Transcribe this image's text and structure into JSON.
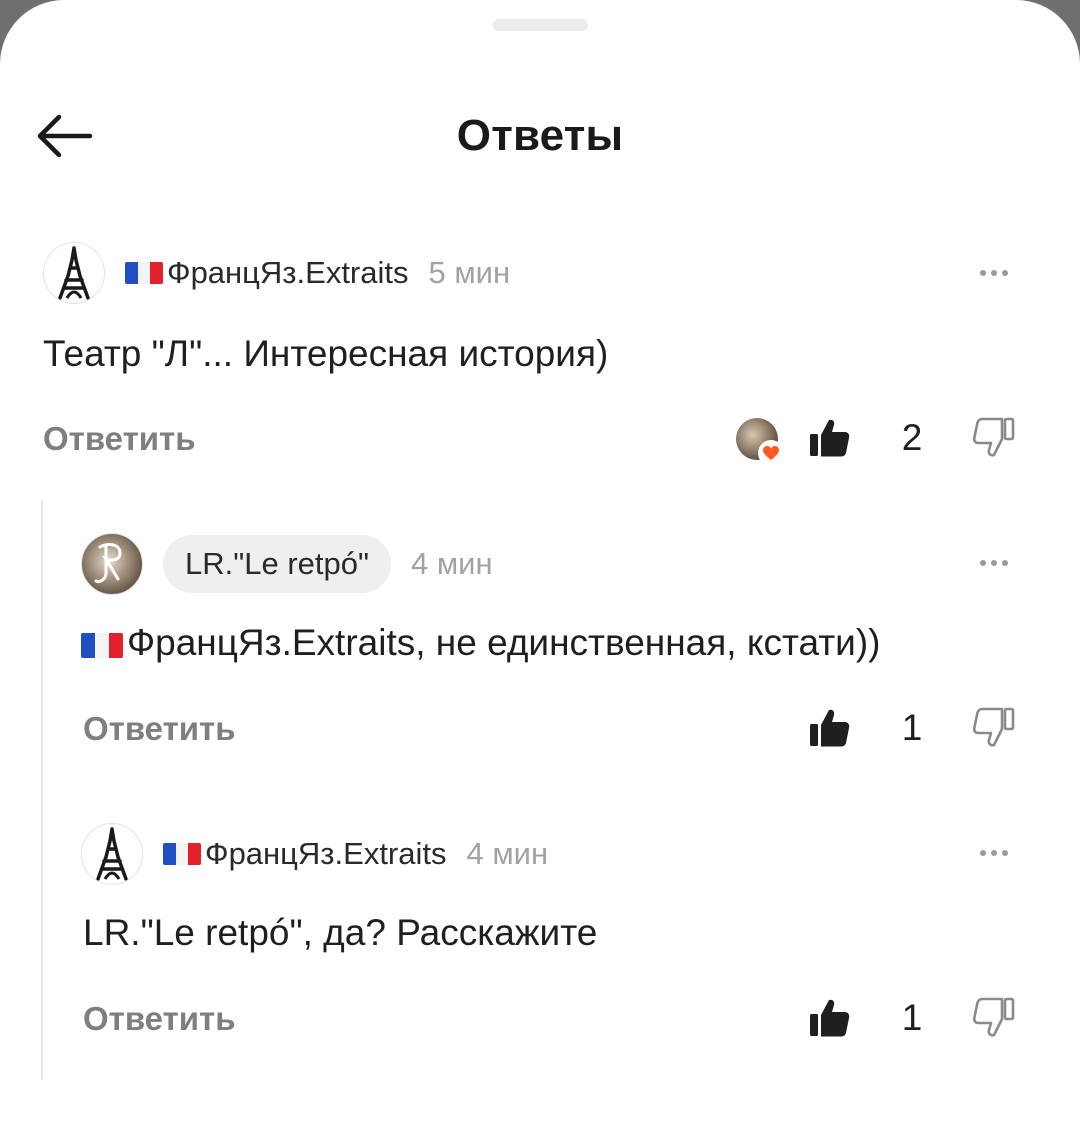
{
  "header": {
    "title": "Ответы"
  },
  "comments": [
    {
      "author": "ФранцЯз.Extraits",
      "time": "5 мин",
      "text": "Театр \"Л\"... Интересная история)",
      "reply_label": "Ответить",
      "likes": "2"
    },
    {
      "author": "LR.\"Le retpó\"",
      "time": "4 мин",
      "text": "ФранцЯз.Extraits, не единственная, кстати))",
      "reply_label": "Ответить",
      "likes": "1"
    },
    {
      "author": "ФранцЯз.Extraits",
      "time": "4 мин",
      "text": "LR.\"Le retpó\", да? Расскажите",
      "reply_label": "Ответить",
      "likes": "1"
    }
  ],
  "icons": {
    "back": "arrow-left-icon",
    "more": "more-dots-icon",
    "like": "thumbs-up-icon",
    "dislike": "thumbs-down-icon",
    "flag": "french-flag-icon",
    "reaction": "heart-icon"
  },
  "colors": {
    "flag_blue": "#1f4fc0",
    "flag_white": "#f4f4f4",
    "flag_red": "#e2212b",
    "heart": "#ff5a1f"
  }
}
